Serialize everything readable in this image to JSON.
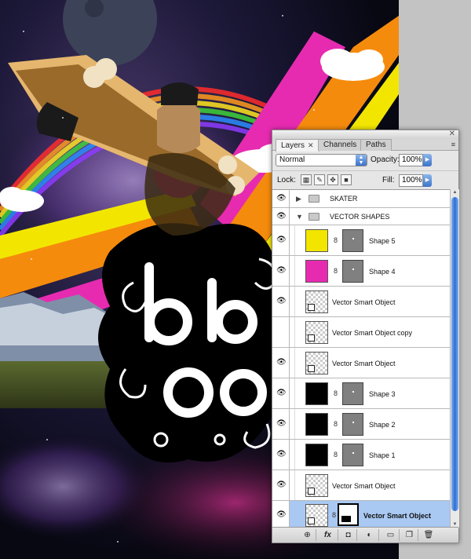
{
  "panel": {
    "close_glyph": "✕",
    "menu_glyph": "≡",
    "tabs": [
      {
        "label": "Layers",
        "active": true,
        "close": "✕"
      },
      {
        "label": "Channels",
        "active": false
      },
      {
        "label": "Paths",
        "active": false
      }
    ],
    "blend_mode": "Normal",
    "opacity_label": "Opacity:",
    "opacity_value": "100%",
    "lock_label": "Lock:",
    "fill_label": "Fill:",
    "fill_value": "100%",
    "groups": [
      {
        "name": "SKATER",
        "expanded": false
      },
      {
        "name": "VECTOR SHAPES",
        "expanded": true
      }
    ],
    "layers": [
      {
        "name": "Shape 5",
        "thumb_color": "#f2e600",
        "type": "shape"
      },
      {
        "name": "Shape 4",
        "thumb_color": "#e72bb1",
        "type": "shape"
      },
      {
        "name": "Vector Smart Object",
        "type": "smart"
      },
      {
        "name": "Vector Smart Object copy",
        "type": "smart"
      },
      {
        "name": "Vector Smart Object",
        "type": "smart"
      },
      {
        "name": "Shape 3",
        "thumb_color": "#000000",
        "type": "shape"
      },
      {
        "name": "Shape 2",
        "thumb_color": "#000000",
        "type": "shape"
      },
      {
        "name": "Shape 1",
        "thumb_color": "#000000",
        "type": "shape"
      },
      {
        "name": "Vector Smart Object",
        "type": "smart"
      },
      {
        "name": "Vector Smart Object",
        "type": "smart-mask",
        "selected": true
      }
    ],
    "footer_buttons": [
      "link-icon",
      "fx-icon",
      "mask-icon",
      "adjustment-icon",
      "folder-icon",
      "new-layer-icon",
      "trash-icon"
    ],
    "footer_glyphs": [
      "⊕",
      "fx",
      "◘",
      "◐",
      "▭",
      "❐",
      "🗑"
    ],
    "eye_glyph": "👁",
    "arrow_collapsed": "▶",
    "arrow_expanded": "▼",
    "chain_glyph": "8"
  },
  "colors": {
    "accent_blue": "#3a73c9",
    "selected_row": "#a9c8f2",
    "stripe_pink": "#e72bb1",
    "stripe_orange": "#f58b0c",
    "stripe_yellow": "#f2e600"
  }
}
